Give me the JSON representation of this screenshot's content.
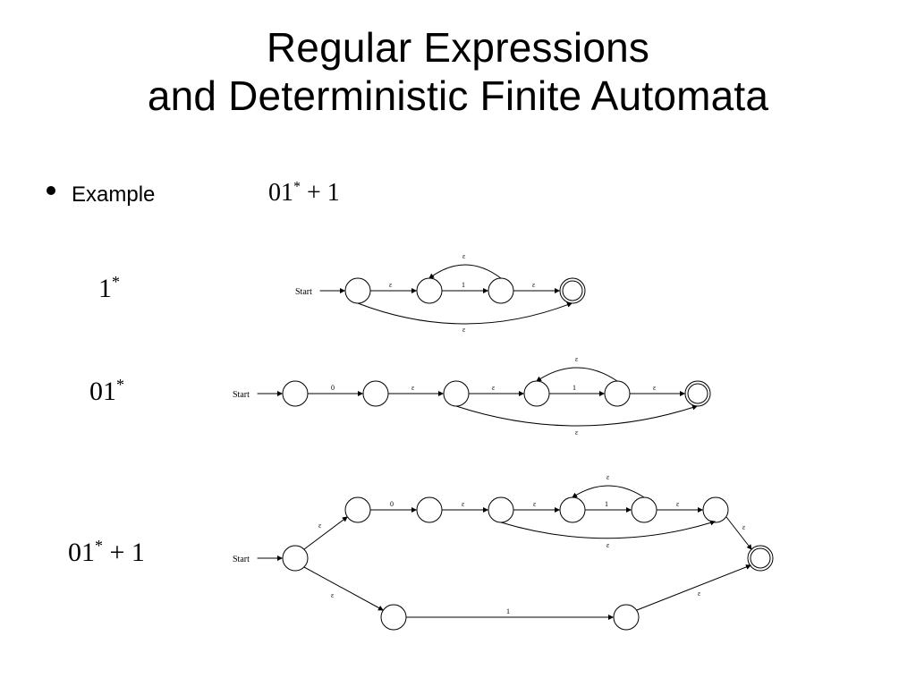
{
  "title_line1": "Regular Expressions",
  "title_line2": "and Deterministic Finite Automata",
  "bullet_label": "Example",
  "top_expr_html": "01* + 1",
  "labels": {
    "one_star": "1*",
    "zero_one_star": "01*",
    "zero_one_star_plus_one": "01* + 1"
  },
  "diagrams": {
    "d1": {
      "start": "Start",
      "eps": "ε",
      "sym": "1",
      "states": 4,
      "accept_last": true,
      "loop_back_top": true,
      "skip_forward_bottom": true
    },
    "d2": {
      "start": "Start",
      "eps": "ε",
      "sym0": "0",
      "sym1": "1",
      "states": 6,
      "accept_last": true,
      "loop_back_top": "partial",
      "skip_forward_bottom": "partial"
    },
    "d3": {
      "start": "Start",
      "eps": "ε",
      "sym0": "0",
      "sym1": "1",
      "branches": 2,
      "upper_states": 6,
      "lower_states": 2,
      "accept_last": true
    }
  }
}
